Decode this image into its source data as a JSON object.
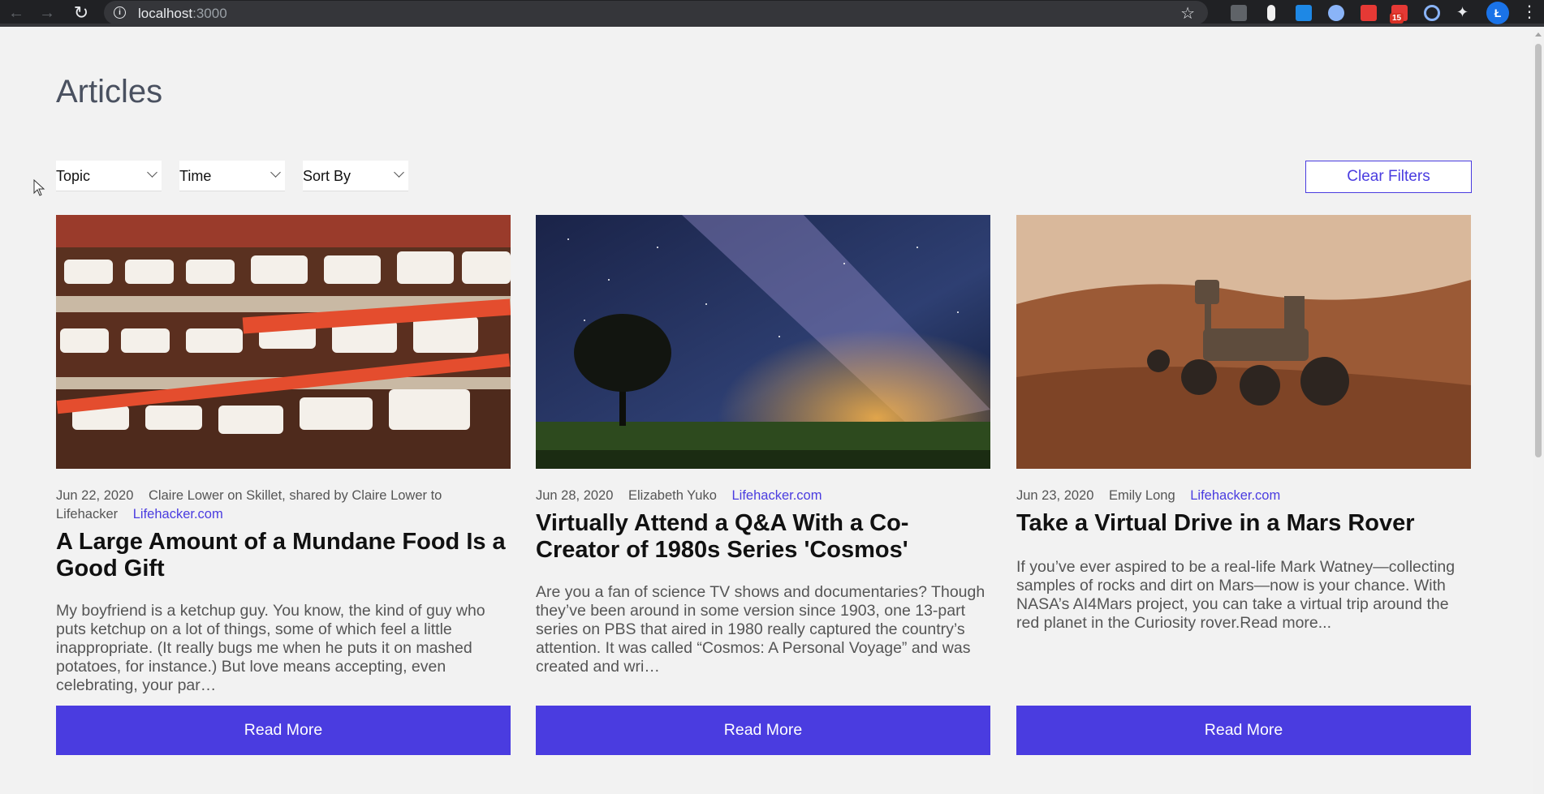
{
  "browser": {
    "url_host": "localhost",
    "url_port": ":3000",
    "profile_initial": "Ł",
    "notification_count": "15"
  },
  "page": {
    "title": "Articles"
  },
  "filters": {
    "topic_label": "Topic",
    "time_label": "Time",
    "sort_label": "Sort By",
    "clear_label": "Clear Filters"
  },
  "articles": [
    {
      "date": "Jun 22, 2020",
      "author": "Claire Lower on Skillet, shared by Claire Lower to Lifehacker",
      "source": "Lifehacker.com",
      "title": "A Large Amount of a Mundane Food Is a Good Gift",
      "summary": "My boyfriend is a ketchup guy. You know, the kind of guy who puts ketchup on a lot of things, some of which feel a little inappropriate. (It really bugs me when he puts it on mashed potatoes, for instance.) But love means accepting, even celebrating, your par…",
      "button_label": "Read More",
      "image": "nutella jars on store shelves"
    },
    {
      "date": "Jun 28, 2020",
      "author": "Elizabeth Yuko",
      "source": "Lifehacker.com",
      "title": "Virtually Attend a Q&A With a Co-Creator of 1980s Series 'Cosmos'",
      "summary": "Are you a fan of science TV shows and documentaries? Though they’ve been around in some version since 1903, one 13-part series on PBS that aired in 1980 really captured the country’s attention. It was called “Cosmos: A Personal Voyage” and was created and wri…",
      "button_label": "Read More",
      "image": "milky way over a lone tree"
    },
    {
      "date": "Jun 23, 2020",
      "author": "Emily Long",
      "source": "Lifehacker.com",
      "title": "Take a Virtual Drive in a Mars Rover",
      "summary": "If you’ve ever aspired to be a real-life Mark Watney—collecting samples of rocks and dirt on Mars—now is your chance. With NASA’s AI4Mars project, you can take a virtual trip around the red planet in the Curiosity rover.Read more...",
      "button_label": "Read More",
      "image": "curiosity rover on mars"
    }
  ],
  "colors": {
    "accent": "#4a3ce0",
    "background": "#f2f2f2",
    "chrome": "#202124"
  }
}
